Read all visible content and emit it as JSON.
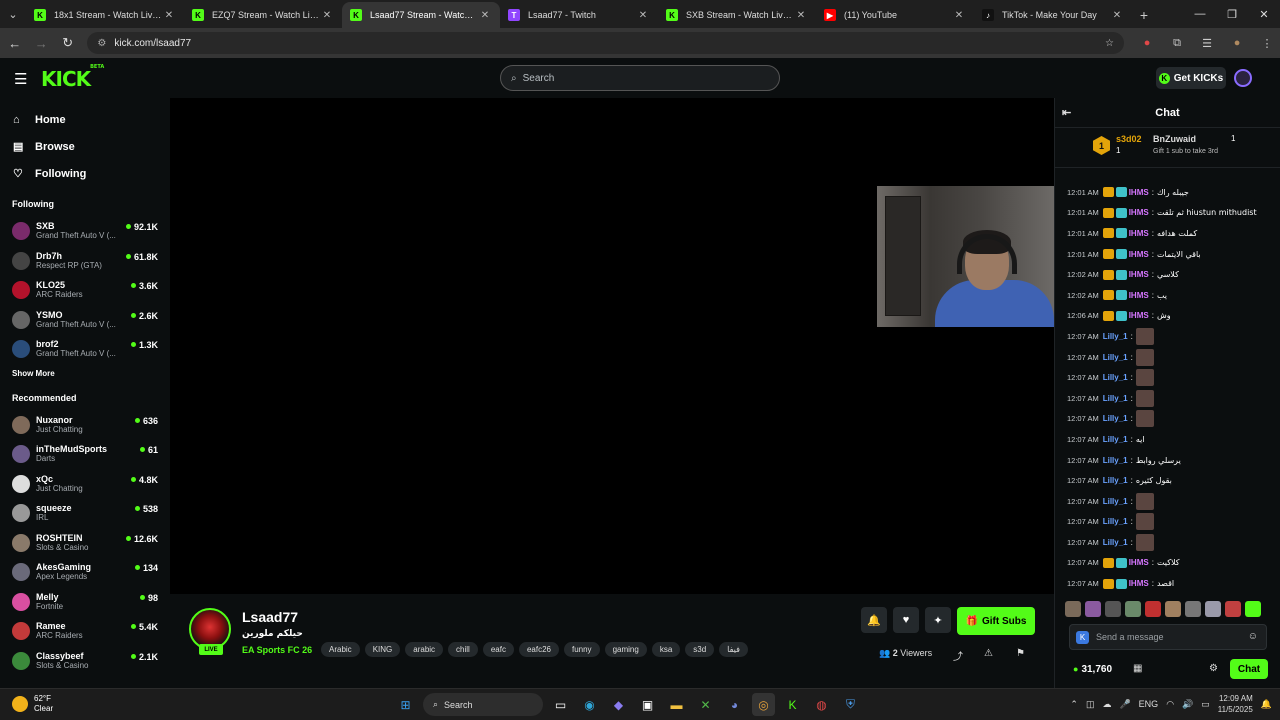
{
  "browser": {
    "tabs": [
      {
        "title": "18x1 Stream - Watch Live on Kick",
        "icon": "K",
        "color": "#53fc18",
        "active": false
      },
      {
        "title": "EZQ7 Stream - Watch Live on Kick",
        "icon": "K",
        "color": "#53fc18",
        "active": false
      },
      {
        "title": "Lsaad77 Stream - Watch Live on Kick",
        "icon": "K",
        "color": "#53fc18",
        "active": true
      },
      {
        "title": "Lsaad77 - Twitch",
        "icon": "T",
        "color": "#9146ff",
        "active": false
      },
      {
        "title": "SXB Stream - Watch Live on Kick",
        "icon": "K",
        "color": "#53fc18",
        "active": false
      },
      {
        "title": "(11) YouTube",
        "icon": "▶",
        "color": "#ff0000",
        "active": false
      },
      {
        "title": "TikTok - Make Your Day",
        "icon": "♪",
        "color": "#111111",
        "active": false
      }
    ],
    "url": "kick.com/lsaad77"
  },
  "header": {
    "logo": "KICK",
    "logo_sup": "BETA",
    "search_placeholder": "Search",
    "get_kicks": "Get KICKs"
  },
  "sidebar": {
    "nav": [
      {
        "label": "Home",
        "icon": "⌂"
      },
      {
        "label": "Browse",
        "icon": "▤"
      },
      {
        "label": "Following",
        "icon": "♡"
      }
    ],
    "following_title": "Following",
    "following": [
      {
        "name": "SXB",
        "category": "Grand Theft Auto V (...",
        "viewers": "92.1K",
        "color": "#7a2b6b"
      },
      {
        "name": "Drb7h",
        "category": "Respect RP (GTA)",
        "viewers": "61.8K",
        "color": "#444"
      },
      {
        "name": "KLO25",
        "category": "ARC Raiders",
        "viewers": "3.6K",
        "color": "#b3122b"
      },
      {
        "name": "YSMO",
        "category": "Grand Theft Auto V (...",
        "viewers": "2.6K",
        "color": "#666"
      },
      {
        "name": "brof2",
        "category": "Grand Theft Auto V (...",
        "viewers": "1.3K",
        "color": "#2a4d7a"
      }
    ],
    "show_more": "Show More",
    "recommended_title": "Recommended",
    "recommended": [
      {
        "name": "Nuxanor",
        "category": "Just Chatting",
        "viewers": "636",
        "color": "#7f6a5a"
      },
      {
        "name": "inTheMudSports",
        "category": "Darts",
        "viewers": "61",
        "color": "#6b5b8a"
      },
      {
        "name": "xQc",
        "category": "Just Chatting",
        "viewers": "4.8K",
        "color": "#ddd"
      },
      {
        "name": "squeeze",
        "category": "IRL",
        "viewers": "538",
        "color": "#999"
      },
      {
        "name": "ROSHTEIN",
        "category": "Slots & Casino",
        "viewers": "12.6K",
        "color": "#8a7a6a"
      },
      {
        "name": "AkesGaming",
        "category": "Apex Legends",
        "viewers": "134",
        "color": "#6a6a7a"
      },
      {
        "name": "Melly",
        "category": "Fortnite",
        "viewers": "98",
        "color": "#d84fa0"
      },
      {
        "name": "Ramee",
        "category": "ARC Raiders",
        "viewers": "5.4K",
        "color": "#c23a3a"
      },
      {
        "name": "Classybeef",
        "category": "Slots & Casino",
        "viewers": "2.1K",
        "color": "#3b8a3b"
      }
    ]
  },
  "stream": {
    "name": "Lsaad77",
    "title": "حيلكم ملورين",
    "category": "EA Sports FC 26",
    "live": "LIVE",
    "tags": [
      "Arabic",
      "KING",
      "arabic",
      "chill",
      "eafc",
      "eafc26",
      "funny",
      "gaming",
      "ksa",
      "s3d",
      "فيفا"
    ],
    "gift_subs": "Gift Subs",
    "viewers_count": "2",
    "viewers_label": "Viewers"
  },
  "chat": {
    "title": "Chat",
    "leaderboard": {
      "rank1": "1",
      "user1": "s3d02",
      "count1": "1",
      "user2": "BnZuwaid",
      "count2": "1",
      "third_text": "Gift 1 sub to take 3rd"
    },
    "messages": [
      {
        "time": "12:01 AM",
        "user": "IHMS",
        "color": "#d676ff",
        "badges": true,
        "text": "جيبله راك"
      },
      {
        "time": "12:01 AM",
        "user": "IHMS",
        "color": "#d676ff",
        "badges": true,
        "text": "ثم تلقت hiustun mithudist"
      },
      {
        "time": "12:01 AM",
        "user": "IHMS",
        "color": "#d676ff",
        "badges": true,
        "text": "كملت هدافه"
      },
      {
        "time": "12:01 AM",
        "user": "IHMS",
        "color": "#d676ff",
        "badges": true,
        "text": "باقي الايتمات"
      },
      {
        "time": "12:02 AM",
        "user": "IHMS",
        "color": "#d676ff",
        "badges": true,
        "text": "كلاسي"
      },
      {
        "time": "12:02 AM",
        "user": "IHMS",
        "color": "#d676ff",
        "badges": true,
        "text": "يب"
      },
      {
        "time": "12:06 AM",
        "user": "IHMS",
        "color": "#d676ff",
        "badges": true,
        "text": "وش"
      },
      {
        "time": "12:07 AM",
        "user": "Lilly_1",
        "color": "#6aa2ff",
        "badges": false,
        "emote": true
      },
      {
        "time": "12:07 AM",
        "user": "Lilly_1",
        "color": "#6aa2ff",
        "badges": false,
        "emote": true
      },
      {
        "time": "12:07 AM",
        "user": "Lilly_1",
        "color": "#6aa2ff",
        "badges": false,
        "emote": true
      },
      {
        "time": "12:07 AM",
        "user": "Lilly_1",
        "color": "#6aa2ff",
        "badges": false,
        "emote": true
      },
      {
        "time": "12:07 AM",
        "user": "Lilly_1",
        "color": "#6aa2ff",
        "badges": false,
        "emote": true
      },
      {
        "time": "12:07 AM",
        "user": "Lilly_1",
        "color": "#6aa2ff",
        "badges": false,
        "text": "ايه"
      },
      {
        "time": "12:07 AM",
        "user": "Lilly_1",
        "color": "#6aa2ff",
        "badges": false,
        "text": "يرسلي روابط"
      },
      {
        "time": "12:07 AM",
        "user": "Lilly_1",
        "color": "#6aa2ff",
        "badges": false,
        "text": "بقول كثيره"
      },
      {
        "time": "12:07 AM",
        "user": "Lilly_1",
        "color": "#6aa2ff",
        "badges": false,
        "emote": true
      },
      {
        "time": "12:07 AM",
        "user": "Lilly_1",
        "color": "#6aa2ff",
        "badges": false,
        "emote": true
      },
      {
        "time": "12:07 AM",
        "user": "Lilly_1",
        "color": "#6aa2ff",
        "badges": false,
        "emote": true
      },
      {
        "time": "12:07 AM",
        "user": "IHMS",
        "color": "#d676ff",
        "badges": true,
        "text": "كلاكيت"
      },
      {
        "time": "12:07 AM",
        "user": "IHMS",
        "color": "#d676ff",
        "badges": true,
        "text": "اقصد"
      }
    ],
    "emote_colors": [
      "#7a6a5a",
      "#8a5aa0",
      "#555",
      "#6a8a6a",
      "#c03030",
      "#a08060",
      "#777",
      "#9a9aaa",
      "#c04040",
      "#53fc18"
    ],
    "input_placeholder": "Send a message",
    "points": "31,760",
    "chat_button": "Chat"
  },
  "taskbar": {
    "temperature": "62°F",
    "weather": "Clear",
    "search": "Search",
    "lang": "ENG",
    "time": "12:09 AM",
    "date": "11/5/2025"
  }
}
